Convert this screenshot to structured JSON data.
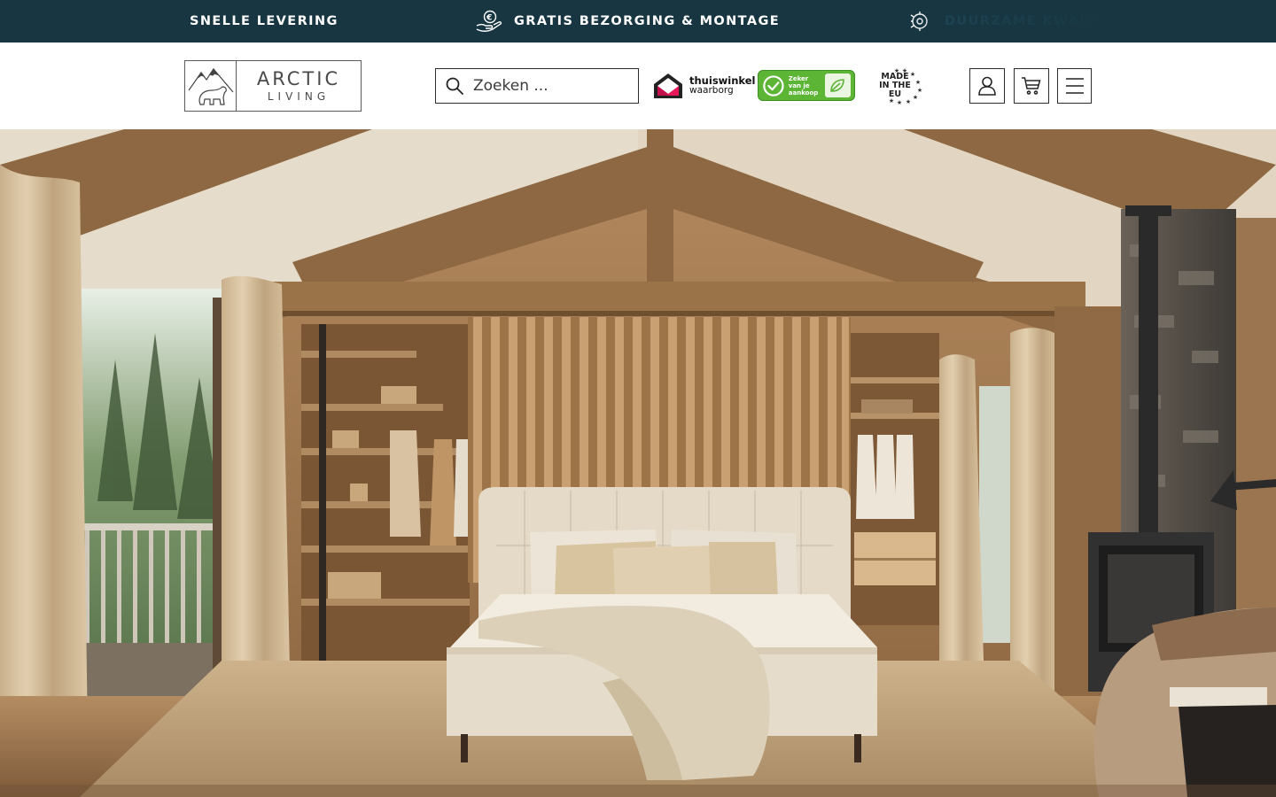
{
  "topbar": {
    "msg1": "SNELLE LEVERING",
    "msg2": "GRATIS BEZORGING & MONTAGE",
    "msg3": "DUURZAME KWALITEIT"
  },
  "header": {
    "logo_line1": "ARCTIC",
    "logo_line2": "LIVING",
    "search_placeholder": "Zoeken ...",
    "thuiswinkel_line1": "thuiswinkel",
    "thuiswinkel_line2": "waarborg",
    "zeker_text": "Zeker van je aankoop",
    "made_in_eu": "MADE IN THE EU"
  },
  "icons": {
    "search": "search-icon",
    "account": "user-icon",
    "cart": "cart-icon",
    "menu": "hamburger-icon",
    "euro_hand": "euro-hand-icon",
    "gear": "gear-icon"
  },
  "colors": {
    "topbar_bg": "#173642",
    "brand_text": "#4a4a4a",
    "badge_green": "#5db536"
  },
  "hero": {
    "alt": "Bedroom with beige boxspring bed in a wooden cabin"
  }
}
